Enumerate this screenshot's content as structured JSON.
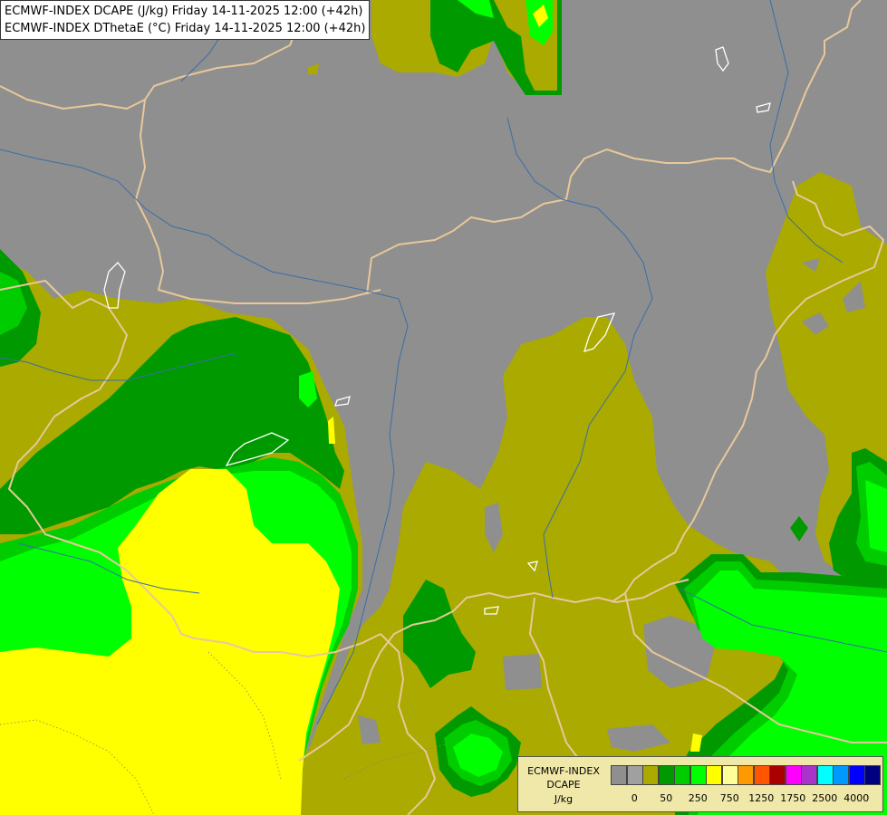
{
  "header": {
    "line1": "ECMWF-INDEX DCAPE (J/kg) Friday 14-11-2025 12:00 (+42h)",
    "line2": "ECMWF-INDEX DThetaE (°C) Friday 14-11-2025 12:00 (+42h)"
  },
  "legend": {
    "title1": "ECMWF-INDEX",
    "title2": "DCAPE",
    "unit": "J/kg",
    "swatches": [
      "#8f8f8f",
      "#a0a0a0",
      "#aaaa00",
      "#009900",
      "#00cc00",
      "#00ff00",
      "#ffff00",
      "#ffff99",
      "#ff9900",
      "#ff5500",
      "#aa0000",
      "#ff00ff",
      "#aa33cc",
      "#00ffff",
      "#0099ff",
      "#0000ff",
      "#000080"
    ],
    "ticks": [
      "0",
      "50",
      "250",
      "750",
      "1250",
      "1750",
      "2500",
      "4000"
    ]
  },
  "colors": {
    "background": "#8f8f8f",
    "olive": "#aaaa00",
    "dark_green": "#009900",
    "green": "#00cc00",
    "bright_green": "#00ff00",
    "yellow": "#ffff00",
    "border_line": "#e8c89a",
    "river_line": "#3a6ea8"
  }
}
